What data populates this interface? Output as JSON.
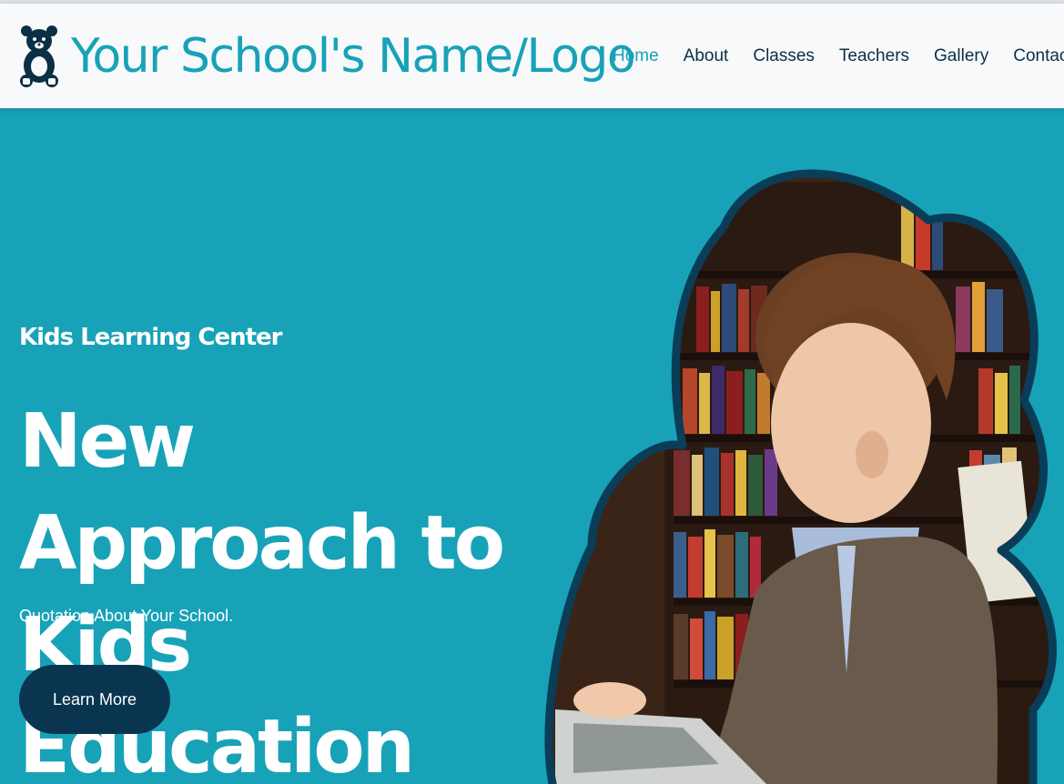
{
  "header": {
    "brand_text": "Your School's Name/Logo",
    "brand_icon": "teddy-bear-icon",
    "nav": [
      {
        "label": "Home",
        "active": true
      },
      {
        "label": "About",
        "active": false
      },
      {
        "label": "Classes",
        "active": false
      },
      {
        "label": "Teachers",
        "active": false
      },
      {
        "label": "Gallery",
        "active": false
      },
      {
        "label": "Contact",
        "active": false
      }
    ]
  },
  "hero": {
    "subtitle": "Kids Learning Center",
    "title": "New Approach to Kids Education",
    "quote": "Quotation About Your School.",
    "button_label": "Learn More",
    "image_alt": "boy reading a book in a library"
  },
  "colors": {
    "accent": "#17a2b8",
    "hero_bg": "#17a2b8",
    "navbar_bg": "#f8f9fa",
    "nav_text": "#0b2f45",
    "button_bg": "#0a3550",
    "blob_border": "#0a3d57"
  }
}
